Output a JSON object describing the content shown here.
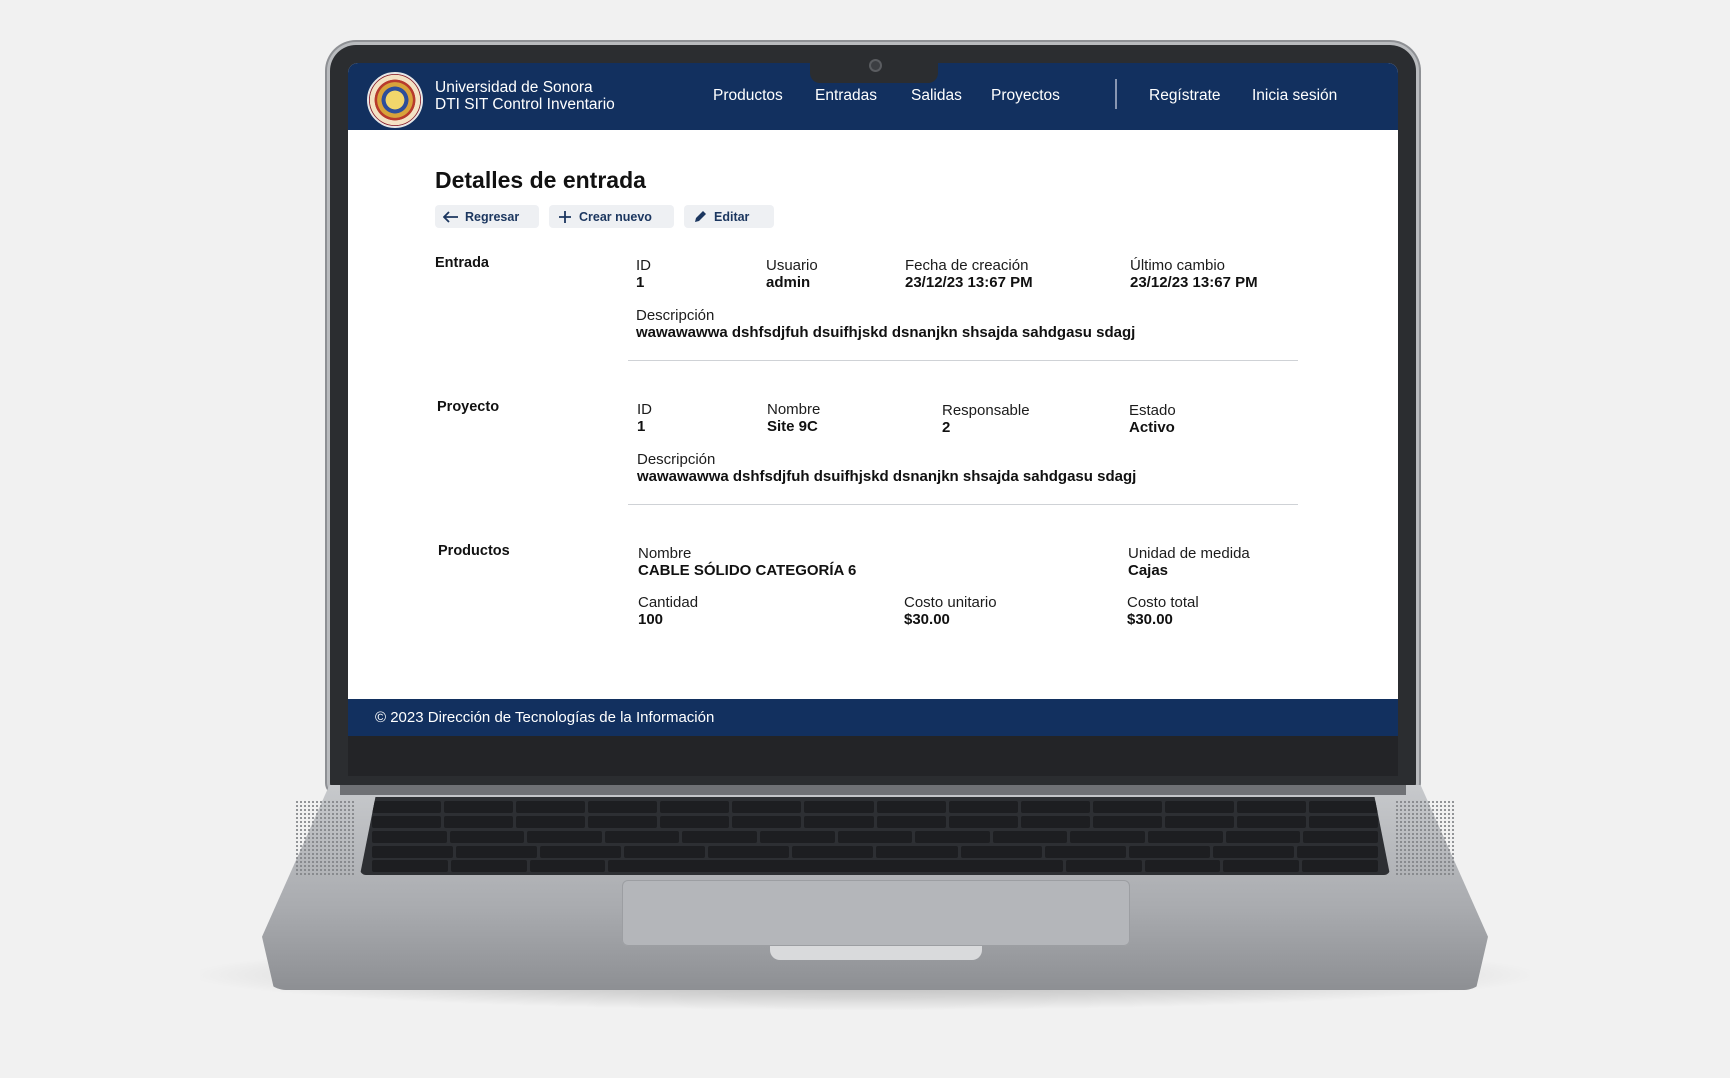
{
  "header": {
    "brand_line1": "Universidad de Sonora",
    "brand_line2": "DTI SIT Control Inventario",
    "nav": [
      "Productos",
      "Entradas",
      "Salidas",
      "Proyectos"
    ],
    "auth": [
      "Regístrate",
      "Inicia sesión"
    ]
  },
  "page": {
    "title": "Detalles de entrada",
    "actions": [
      {
        "label": "Regresar",
        "icon": "arrow-left-icon"
      },
      {
        "label": "Crear nuevo",
        "icon": "plus-icon"
      },
      {
        "label": "Editar",
        "icon": "pencil-icon"
      }
    ]
  },
  "entrada": {
    "title": "Entrada",
    "fields": [
      {
        "label": "ID",
        "value": "1"
      },
      {
        "label": "Usuario",
        "value": "admin"
      },
      {
        "label": "Fecha de creación",
        "value": "23/12/23 13:67 PM"
      },
      {
        "label": "Último cambio",
        "value": "23/12/23 13:67 PM"
      }
    ],
    "desc_label": "Descripción",
    "desc_value": "wawawawwa dshfsdjfuh dsuifhjskd dsnanjkn shsajda sahdgasu sdagj"
  },
  "proyecto": {
    "title": "Proyecto",
    "fields": [
      {
        "label": "ID",
        "value": "1"
      },
      {
        "label": "Nombre",
        "value": "Site 9C"
      },
      {
        "label": "Responsable",
        "value": "2"
      },
      {
        "label": "Estado",
        "value": "Activo"
      }
    ],
    "desc_label": "Descripción",
    "desc_value": "wawawawwa dshfsdjfuh dsuifhjskd dsnanjkn shsajda sahdgasu sdagj"
  },
  "productos": {
    "title": "Productos",
    "nombre_label": "Nombre",
    "nombre_value": "CABLE SÓLIDO CATEGORÍA 6",
    "unidad_label": "Unidad de medida",
    "unidad_value": "Cajas",
    "cantidad_label": "Cantidad",
    "cantidad_value": "100",
    "costo_unitario_label": "Costo unitario",
    "costo_unitario_value": "$30.00",
    "costo_total_label": "Costo total",
    "costo_total_value": "$30.00"
  },
  "footer": {
    "text": "© 2023 Dirección de Tecnologías de la Información"
  },
  "colors": {
    "header_bg": "#12305f",
    "button_text": "#1b365f",
    "button_bg": "#eef0f3"
  }
}
